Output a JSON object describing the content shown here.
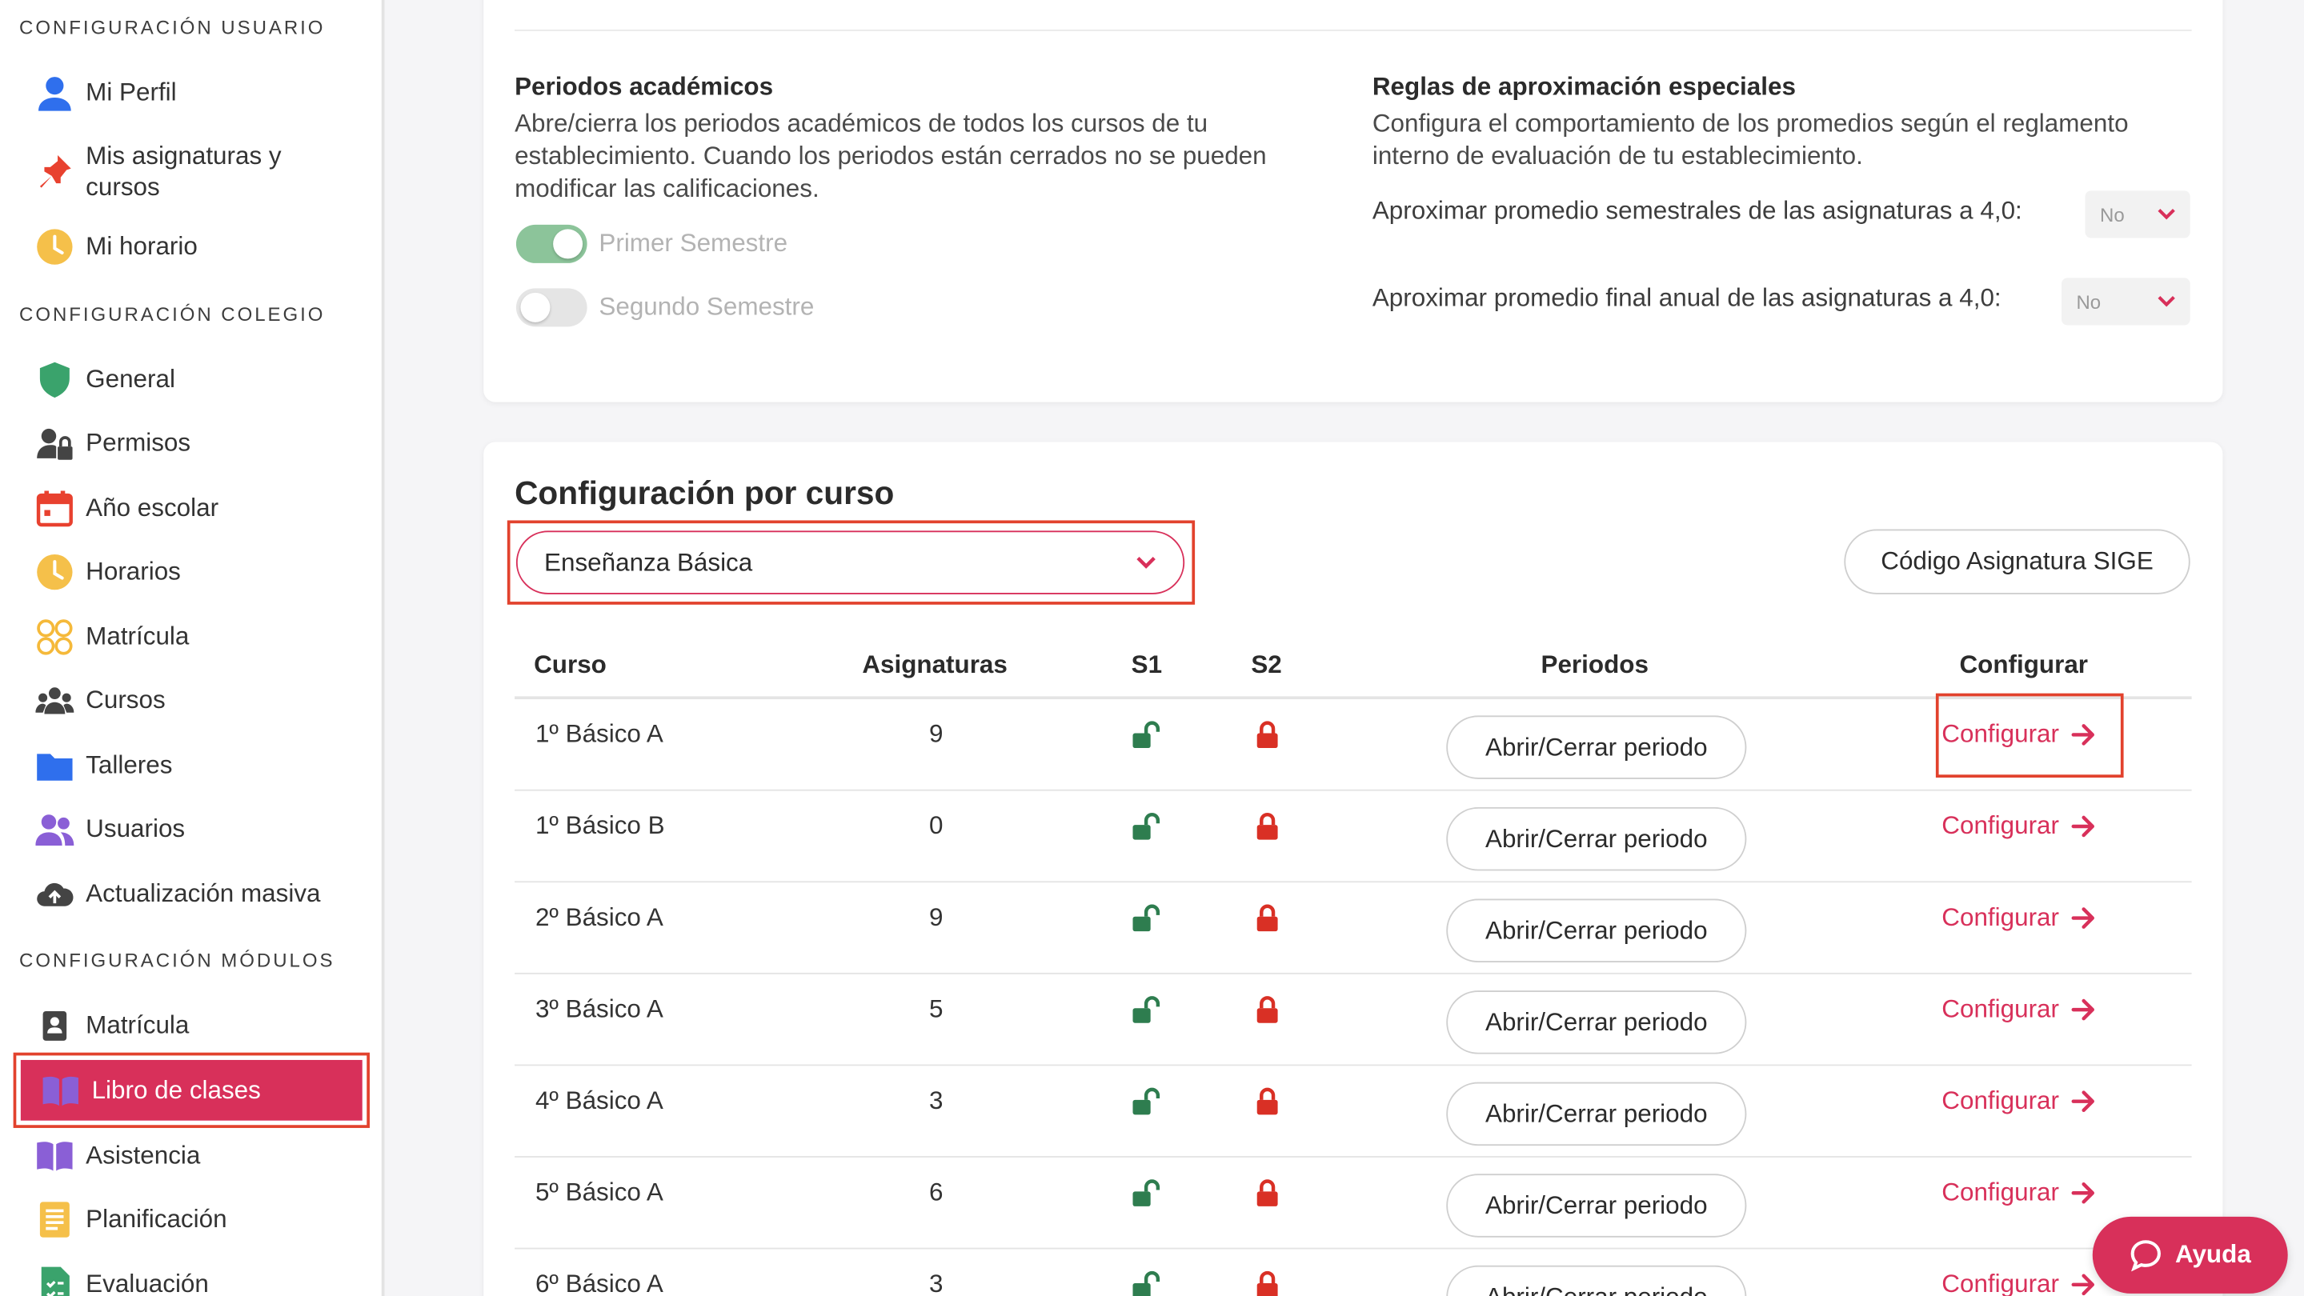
{
  "sidebar": {
    "sections": [
      {
        "title": "CONFIGURACIÓN USUARIO"
      },
      {
        "title": "CONFIGURACIÓN COLEGIO"
      },
      {
        "title": "CONFIGURACIÓN MÓDULOS"
      }
    ],
    "user_items": [
      {
        "label": "Mi Perfil",
        "icon": "user-icon"
      },
      {
        "label": "Mis asignaturas y cursos",
        "icon": "pin-icon"
      },
      {
        "label": "Mi horario",
        "icon": "clock-icon"
      }
    ],
    "school_items": [
      {
        "label": "General",
        "icon": "shield-icon"
      },
      {
        "label": "Permisos",
        "icon": "user-lock-icon"
      },
      {
        "label": "Año escolar",
        "icon": "calendar-icon"
      },
      {
        "label": "Horarios",
        "icon": "clock-icon"
      },
      {
        "label": "Matrícula",
        "icon": "faces-icon"
      },
      {
        "label": "Cursos",
        "icon": "users-group-icon"
      },
      {
        "label": "Talleres",
        "icon": "folder-icon"
      },
      {
        "label": "Usuarios",
        "icon": "users-icon"
      },
      {
        "label": "Actualización masiva",
        "icon": "cloud-upload-icon"
      }
    ],
    "module_items": [
      {
        "label": "Matrícula",
        "icon": "contact-card-icon"
      },
      {
        "label": "Libro de clases",
        "icon": "book-icon",
        "active": true
      },
      {
        "label": "Asistencia",
        "icon": "book-icon"
      },
      {
        "label": "Planificación",
        "icon": "notes-icon"
      },
      {
        "label": "Evaluación",
        "icon": "checklist-icon"
      }
    ]
  },
  "periods": {
    "title": "Periodos académicos",
    "description": "Abre/cierra los periodos académicos de todos los cursos de tu establecimiento. Cuando los periodos están cerrados no se pueden modificar las calificaciones.",
    "toggles": [
      {
        "label": "Primer Semestre",
        "on": true
      },
      {
        "label": "Segundo Semestre",
        "on": false
      }
    ]
  },
  "rules": {
    "title": "Reglas de aproximación especiales",
    "description": "Configura el comportamiento de los promedios según el reglamento interno de evaluación de tu establecimiento.",
    "items": [
      {
        "label": "Aproximar promedio semestrales de las asignaturas a 4,0:",
        "value": "No"
      },
      {
        "label": "Aproximar promedio final anual de las asignaturas a 4,0:",
        "value": "No"
      }
    ]
  },
  "course_config": {
    "title": "Configuración por curso",
    "level_selected": "Enseñanza Básica",
    "sige_button": "Código Asignatura SIGE",
    "columns": [
      "Curso",
      "Asignaturas",
      "S1",
      "S2",
      "Periodos",
      "Configurar"
    ],
    "period_button": "Abrir/Cerrar periodo",
    "configure_link": "Configurar",
    "rows": [
      {
        "course": "1º Básico A",
        "subjects": "9",
        "s1": "open",
        "s2": "closed"
      },
      {
        "course": "1º Básico B",
        "subjects": "0",
        "s1": "open",
        "s2": "closed"
      },
      {
        "course": "2º Básico A",
        "subjects": "9",
        "s1": "open",
        "s2": "closed"
      },
      {
        "course": "3º Básico A",
        "subjects": "5",
        "s1": "open",
        "s2": "closed"
      },
      {
        "course": "4º Básico A",
        "subjects": "3",
        "s1": "open",
        "s2": "closed"
      },
      {
        "course": "5º Básico A",
        "subjects": "6",
        "s1": "open",
        "s2": "closed"
      },
      {
        "course": "6º Básico A",
        "subjects": "3",
        "s1": "open",
        "s2": "closed"
      }
    ]
  },
  "help": {
    "label": "Ayuda"
  },
  "colors": {
    "accent": "#d8305a",
    "highlight": "#e2422d",
    "open_lock": "#2e7d4f",
    "closed_lock": "#d93025",
    "toggle_on": "#8cc49a"
  }
}
